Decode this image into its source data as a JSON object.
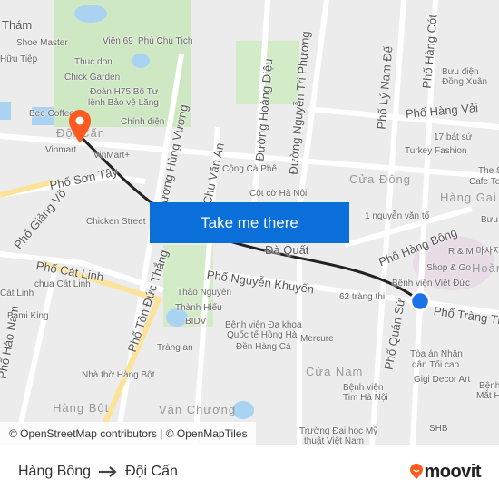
{
  "map": {
    "districts": [
      "Đội Cấn",
      "Cửa Đông",
      "Hàng Gai",
      "Hoàn",
      "Cửa Nam",
      "Hàng Bột",
      "Văn Chương"
    ],
    "streets": [
      "Phố Sơn Tây",
      "Phố Giảng Võ",
      "Phố Cát Linh",
      "Đường Hùng Vương",
      "Chu Văn An",
      "Đường Hoàng Diệu",
      "Đường Nguyễn Tri Phương",
      "Phố Lý Nam Đế",
      "Phố Hàng Cót",
      "Phố Hàng Vải",
      "Phố Hàng Bông",
      "Phố Nguyễn Khuyến",
      "Phố Tôn Đức Thắng",
      "Phố Tràng Thi",
      "Phố Quán Sứ",
      "Phố Hào Nam",
      "Thám",
      "Hữu Tiệp",
      "Đà Quất"
    ],
    "places": [
      "Shoe Master",
      "Viện 69",
      "Phủ Chủ Tịch",
      "Thuc don",
      "Chick Garden",
      "Đoàn H75 Bộ Tư",
      "lệnh Bảo vệ Lăng",
      "Bee Coffee",
      "Chính điện",
      "Vinmart",
      "VinMart+",
      "Cộng Cà Phê",
      "Cột cờ Hà Nội",
      "Chicken Street",
      "chua Cát Linh",
      "Bami King",
      "Thảo Nguyên",
      "Thành Hiếu",
      "BIDV",
      "Bệnh viện Đa khoa",
      "Quốc tế Hồng Hà",
      "Đền Hàng Cá",
      "Tràng an",
      "Mercure",
      "Nhà thờ Hàng Bột",
      "Bệnh viện",
      "Tim Hà Nội",
      "Trường Đại học Mỹ",
      "thuật Việt Nam",
      "SHB",
      "Bệnh viện Việt Đức",
      "Tòa án Nhân",
      "dân Tối cao",
      "Gigi Decor Art",
      "62 tràng thi",
      "1 nguyễn văn tố",
      "R & M 마사지",
      "Shop & Go",
      "17 bát sứ",
      "Turkey Fashion",
      "Bưu điện",
      "Đồng Xuân",
      "The S",
      "Cafe To",
      "Bưu",
      "Bệnh",
      "Mắt H",
      "Cát Linh"
    ],
    "origin_marker_color": "#ff5a1f",
    "destination_marker_color": "#1a73e8",
    "route_color": "#222222"
  },
  "cta": {
    "label": "Take me there"
  },
  "attribution": "© OpenStreetMap contributors | © OpenMapTiles",
  "footer": {
    "from": "Hàng Bông",
    "to": "Đội Cấn",
    "arrow_icon": "arrow-right-icon",
    "logo": "moovit",
    "brand_color": "#ff5a1f"
  }
}
